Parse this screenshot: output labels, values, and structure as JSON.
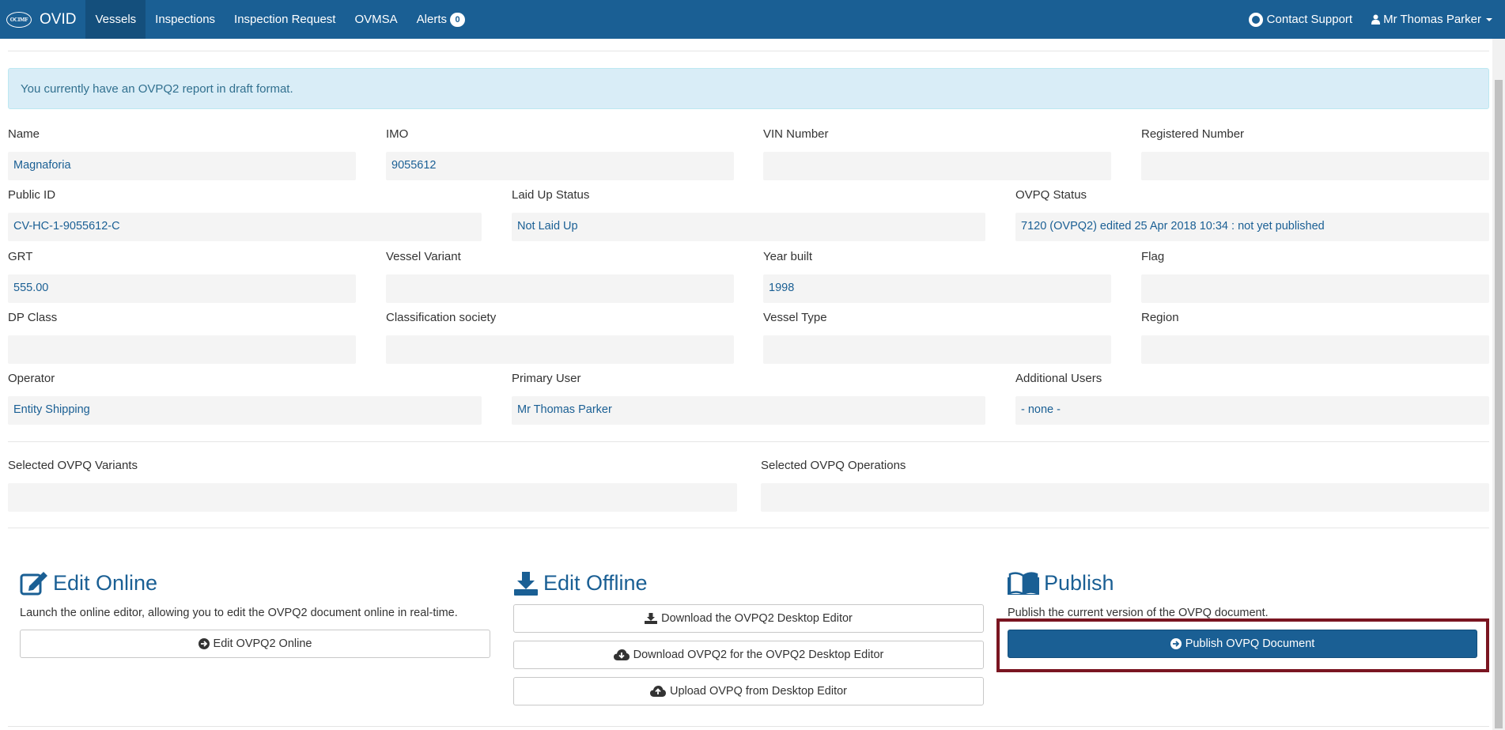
{
  "nav": {
    "brand_logo": "OCIMF",
    "brand_text": "OVID",
    "items": [
      {
        "label": "Vessels",
        "active": true
      },
      {
        "label": "Inspections"
      },
      {
        "label": "Inspection Request"
      },
      {
        "label": "OVMSA"
      },
      {
        "label": "Alerts"
      }
    ],
    "alerts_count": "0",
    "contact_support": "Contact Support",
    "user": "Mr Thomas Parker"
  },
  "alert": "You currently have an OVPQ2 report in draft format.",
  "fields": {
    "name": {
      "label": "Name",
      "value": "Magnaforia"
    },
    "imo": {
      "label": "IMO",
      "value": "9055612"
    },
    "vin": {
      "label": "VIN Number",
      "value": ""
    },
    "registered": {
      "label": "Registered Number",
      "value": ""
    },
    "public_id": {
      "label": "Public ID",
      "value": "CV-HC-1-9055612-C"
    },
    "laid_up": {
      "label": "Laid Up Status",
      "value": "Not Laid Up"
    },
    "ovpq_status": {
      "label": "OVPQ Status",
      "value": "7120 (OVPQ2) edited 25 Apr 2018 10:34 : not yet published"
    },
    "grt": {
      "label": "GRT",
      "value": "555.00"
    },
    "variant": {
      "label": "Vessel Variant",
      "value": ""
    },
    "year": {
      "label": "Year built",
      "value": "1998"
    },
    "flag": {
      "label": "Flag",
      "value": ""
    },
    "dp": {
      "label": "DP Class",
      "value": ""
    },
    "class_soc": {
      "label": "Classification society",
      "value": ""
    },
    "vtype": {
      "label": "Vessel Type",
      "value": ""
    },
    "region": {
      "label": "Region",
      "value": ""
    },
    "operator": {
      "label": "Operator",
      "value": "Entity Shipping"
    },
    "primary": {
      "label": "Primary User",
      "value": "Mr Thomas Parker"
    },
    "additional": {
      "label": "Additional Users",
      "value": "- none -"
    },
    "sel_variants": {
      "label": "Selected OVPQ Variants",
      "value": ""
    },
    "sel_ops": {
      "label": "Selected OVPQ Operations",
      "value": ""
    }
  },
  "edit_online": {
    "title": "Edit Online",
    "desc": "Launch the online editor, allowing you to edit the OVPQ2 document online in real-time.",
    "button": "Edit OVPQ2 Online"
  },
  "edit_offline": {
    "title": "Edit Offline",
    "download_editor": "Download the OVPQ2 Desktop Editor",
    "download_ovpq": "Download OVPQ2 for the OVPQ2 Desktop Editor",
    "upload": "Upload OVPQ from Desktop Editor"
  },
  "publish": {
    "title": "Publish",
    "desc": "Publish the current version of the OVPQ document.",
    "button": "Publish OVPQ Document"
  },
  "colors": {
    "brand": "#1a5f94",
    "alert_bg": "#d9edf7",
    "highlight": "#7a1521"
  }
}
